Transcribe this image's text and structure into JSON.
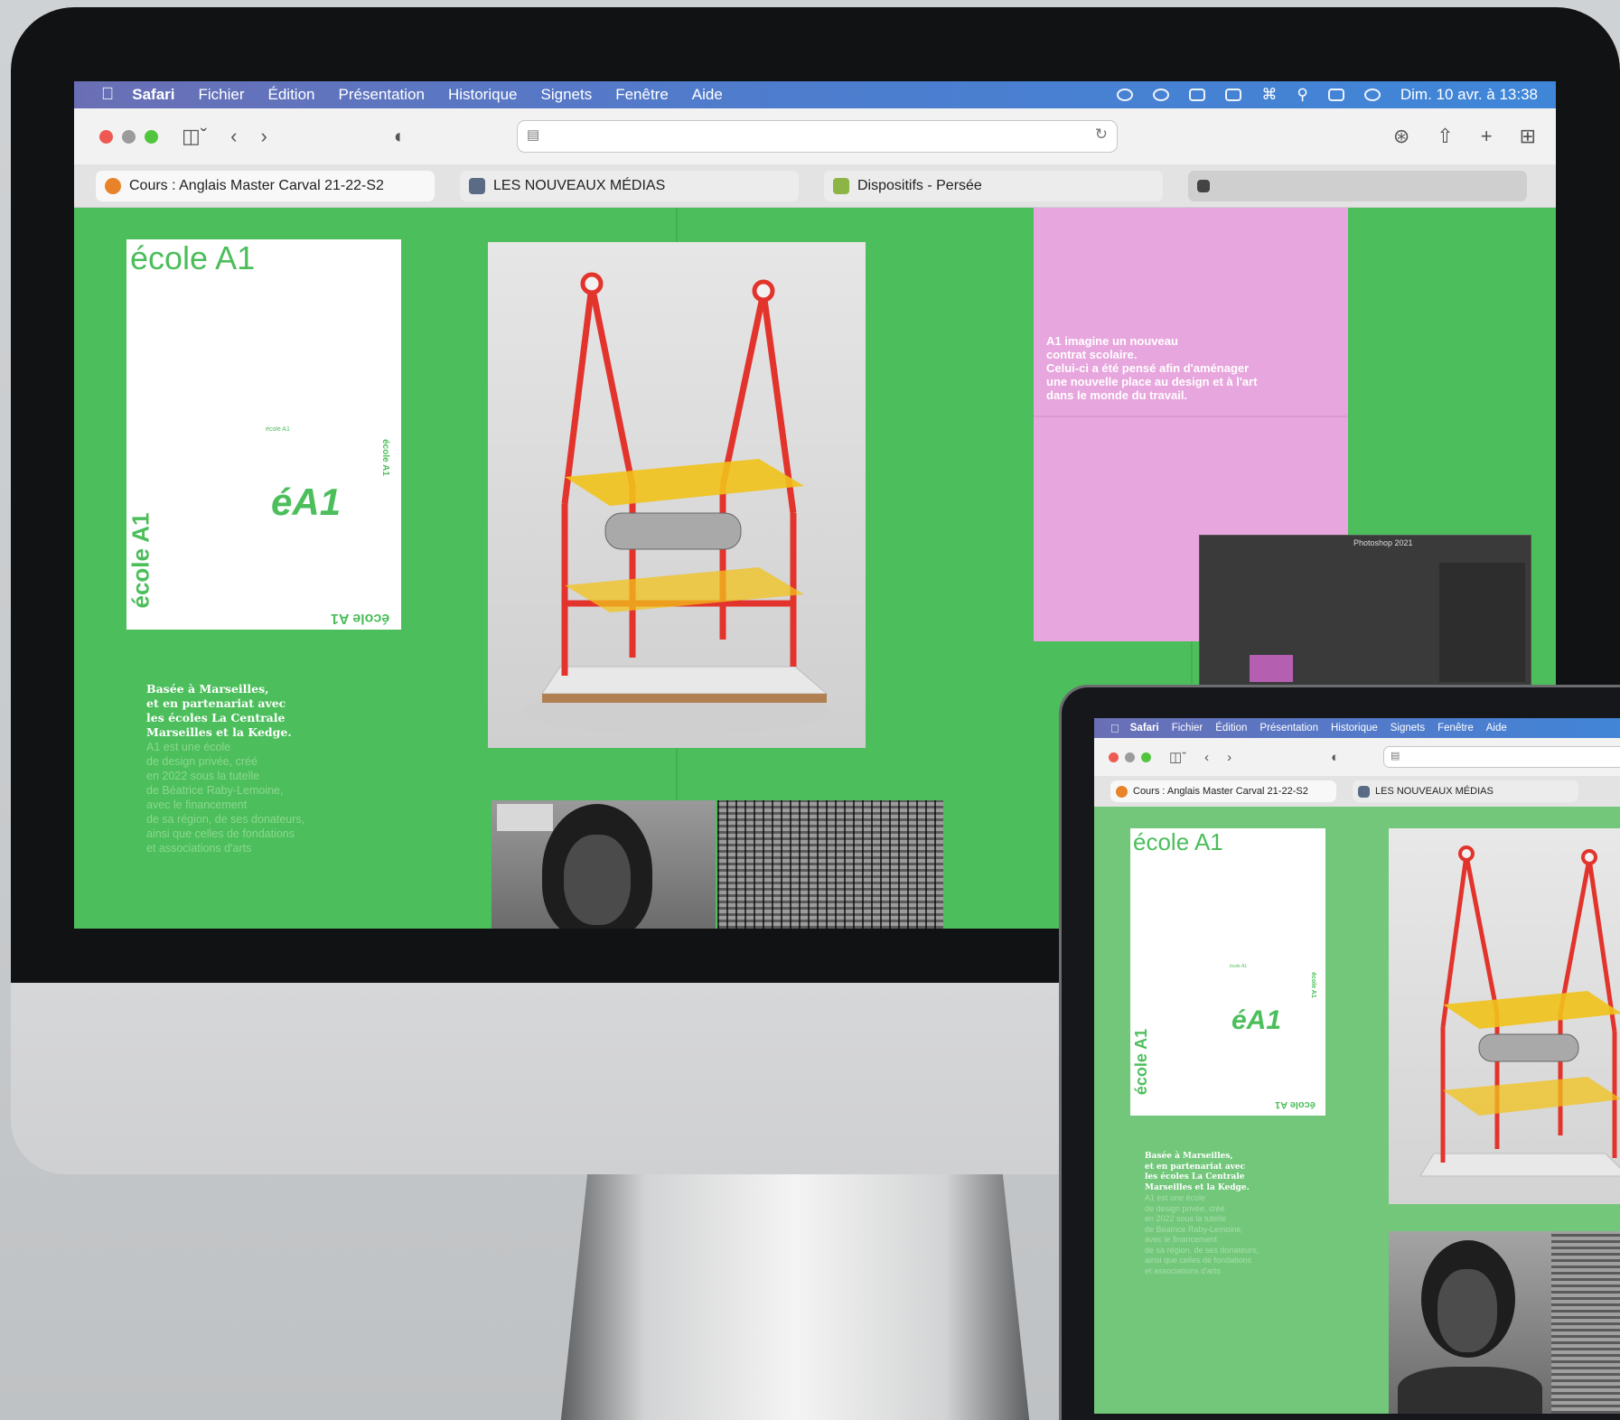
{
  "menubar": {
    "app": "Safari",
    "items": [
      "Fichier",
      "Édition",
      "Présentation",
      "Historique",
      "Signets",
      "Fenêtre",
      "Aide"
    ],
    "clock": "Dim. 10 avr. à 13:38"
  },
  "tabs": [
    {
      "label": "Cours : Anglais Master Carval 21-22-S2",
      "favicon_color": "#e8832a"
    },
    {
      "label": "LES NOUVEAUX MÉDIAS",
      "favicon_color": "#5a6b86"
    },
    {
      "label": "Dispositifs - Persée",
      "favicon_color": "#8db545"
    },
    {
      "label": "",
      "favicon_color": "#444444"
    }
  ],
  "page": {
    "background": "#4cbe5b",
    "poster": {
      "title": "école A1",
      "small_text": "école A1",
      "logo": "éA1",
      "vertical_left": "école A1",
      "vertical_right": "école A1",
      "flipped": "école A1"
    },
    "description": {
      "serif_lines": [
        "Basée à Marseilles,",
        "et en partenariat avec",
        "les écoles La Centrale",
        "Marseilles et la Kedge."
      ],
      "thin_lines": [
        "A1 est une école",
        "de design privée, créé",
        "en 2022 sous la tutelle",
        "de Béatrice Raby-Lemoine,",
        "avec le financement",
        "de sa région, de ses donateurs,",
        "ainsi que celles de fondations",
        "et associations d'arts"
      ]
    },
    "pink_text_lines": [
      "A1 imagine un nouveau",
      "contrat scolaire.",
      "Celui-ci a été pensé afin d'aménager",
      "une nouvelle place au design et à l'art",
      "dans le monde du travail."
    ],
    "ps_window_title": "Photoshop 2021"
  },
  "colors": {
    "green": "#4cbe5b",
    "laptop_green": "#72c77a",
    "pink": "#e7a6dd",
    "sculpture_red": "#e2342c",
    "sculpture_yellow": "#f1c21b",
    "traffic_red": "#ee5a52",
    "traffic_yellow": "#f5bd2f",
    "traffic_green": "#52c53f"
  },
  "icons": [
    "apple-icon",
    "sidebar-icon",
    "back-icon",
    "forward-icon",
    "shield-icon",
    "reader-icon",
    "reload-icon",
    "download-icon",
    "share-icon",
    "new-tab-icon",
    "tab-overview-icon",
    "wifi-icon",
    "search-icon",
    "control-center-icon",
    "siri-icon"
  ]
}
